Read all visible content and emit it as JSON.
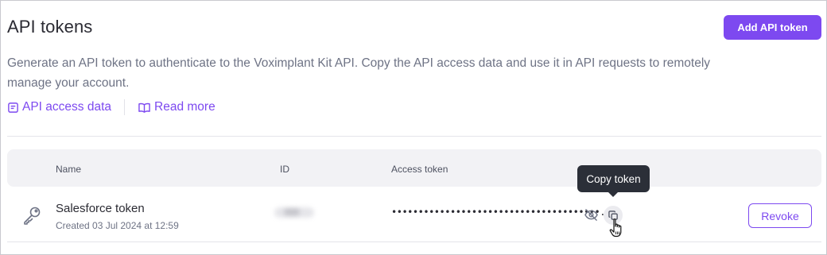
{
  "header": {
    "title": "API tokens",
    "add_button_label": "Add API token"
  },
  "description": "Generate an API token to authenticate to the Voximplant Kit API. Copy the API access data and use it in API requests to remotely manage your account.",
  "links": [
    {
      "label": "API access data",
      "icon": "document-icon"
    },
    {
      "label": "Read more",
      "icon": "open-book-icon"
    }
  ],
  "table": {
    "columns": [
      "Name",
      "ID",
      "Access token"
    ],
    "rows": [
      {
        "icon": "key-icon",
        "name": "Salesforce token",
        "created": "Created 03 Jul 2024 at 12:59",
        "token_masked": "•••••••••••••••••••••••••••••••••••••••...",
        "action_label": "Revoke"
      }
    ]
  },
  "tooltip": "Copy token",
  "colors": {
    "accent": "#7d49f0",
    "text_primary": "#2b2b33",
    "text_secondary": "#6e7385",
    "header_bg": "#f2f2f5",
    "tooltip_bg": "#2b2f38"
  }
}
